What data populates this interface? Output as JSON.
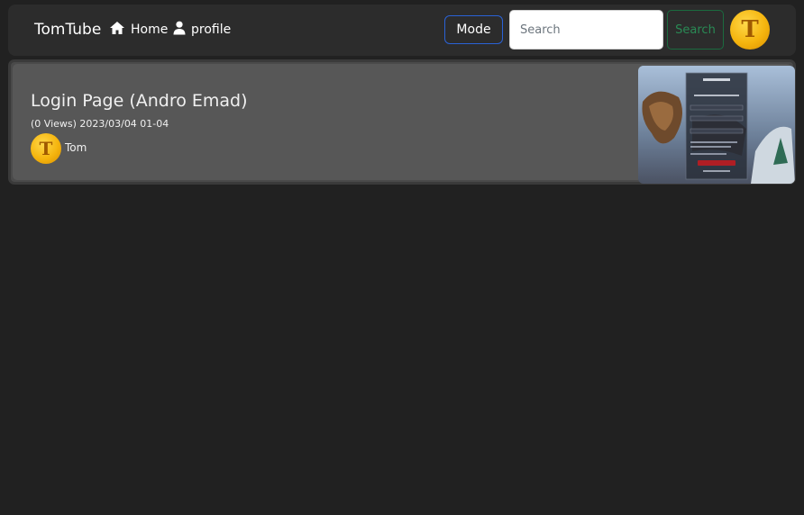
{
  "nav": {
    "brand": "TomTube",
    "home_label": "Home",
    "profile_label": "profile",
    "mode_label": "Mode",
    "search_placeholder": "Search",
    "search_button_label": "Search",
    "avatar_letter": "T"
  },
  "videos": [
    {
      "title": "Login Page (Andro Emad)",
      "meta": "(0 Views) 2023/03/04 01-04",
      "uploader": "Tom",
      "uploader_avatar_letter": "T"
    }
  ],
  "colors": {
    "background": "#212121",
    "navbar": "#2c2c2c",
    "card": "#575757",
    "mode_border": "#2a62d6",
    "search_border": "#1b6b3f",
    "avatar": "#f5b50e"
  }
}
